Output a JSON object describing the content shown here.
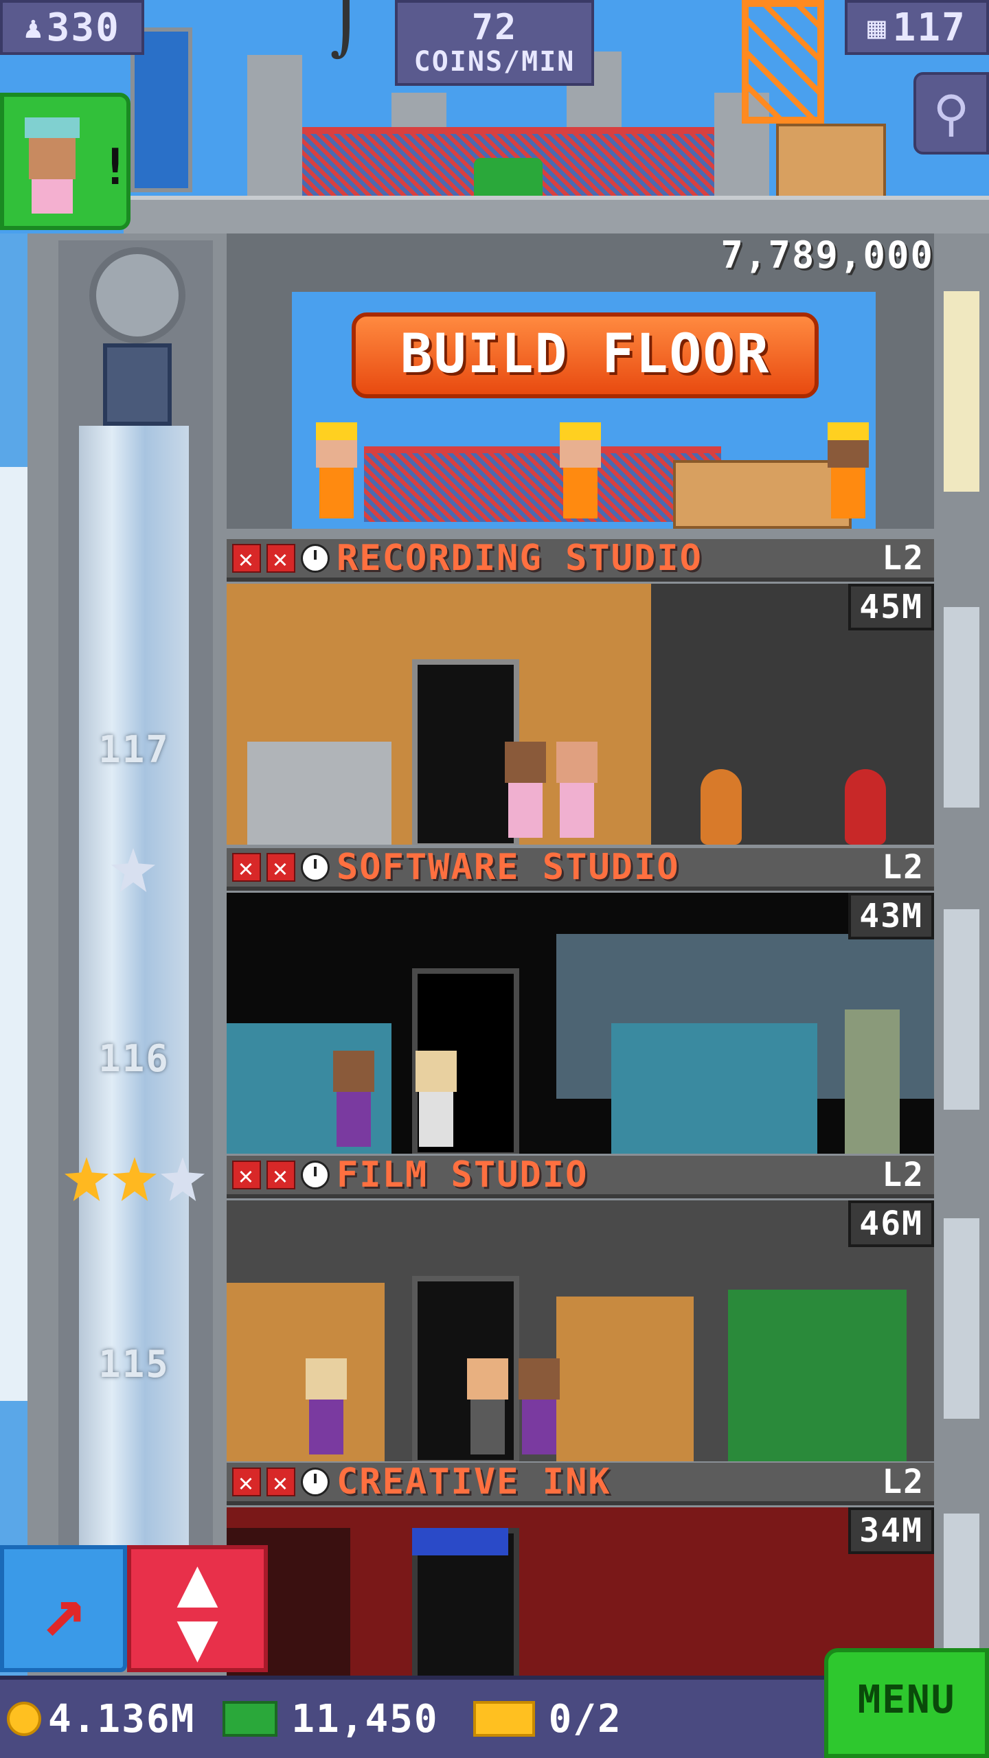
{
  "hud": {
    "population": "330",
    "coins_rate_value": "72",
    "coins_rate_unit": "COINS/MIN",
    "floors": "117"
  },
  "build": {
    "cost": "7,789,000",
    "button_label": "BUILD FLOOR"
  },
  "elevator": {
    "floor_labels": [
      "117",
      "116",
      "115"
    ]
  },
  "floors": [
    {
      "name": "RECORDING STUDIO",
      "level": "L2",
      "earnings": "45M"
    },
    {
      "name": "SOFTWARE STUDIO",
      "level": "L2",
      "earnings": "43M"
    },
    {
      "name": "FILM STUDIO",
      "level": "L2",
      "earnings": "46M"
    },
    {
      "name": "CREATIVE INK",
      "level": "L2",
      "earnings": "34M"
    }
  ],
  "footer": {
    "coins": "4.136M",
    "bux": "11,450",
    "tickets": "0/2",
    "menu_label": "MENU"
  },
  "colors": {
    "sky": "#4aa0ee",
    "build_button": "#f05a20",
    "floor_name": "#ff7040",
    "menu_green": "#2ec82e",
    "elevator_red": "#e8304a",
    "elevator_blue": "#3a9ae8"
  },
  "icons": [
    "person-icon",
    "building-icon",
    "magnify-icon",
    "coin-icon",
    "bux-icon",
    "ticket-icon",
    "arrow-icon",
    "updown-icon",
    "crane-hook-icon",
    "star-icon"
  ]
}
